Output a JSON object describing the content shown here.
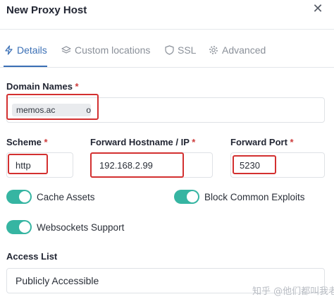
{
  "modal": {
    "title": "New Proxy Host",
    "close_icon": "close-icon"
  },
  "tabs": [
    {
      "label": "Details",
      "icon": "bolt-icon",
      "active": true
    },
    {
      "label": "Custom locations",
      "icon": "layers-icon",
      "active": false
    },
    {
      "label": "SSL",
      "icon": "shield-icon",
      "active": false
    },
    {
      "label": "Advanced",
      "icon": "gear-icon",
      "active": false
    }
  ],
  "form": {
    "domain_names": {
      "label": "Domain Names",
      "required_mark": "*",
      "chip_start": "memos.ac",
      "chip_end": "om"
    },
    "scheme": {
      "label": "Scheme",
      "required_mark": "*",
      "value": "http"
    },
    "forward_hostname": {
      "label": "Forward Hostname / IP",
      "required_mark": "*",
      "value": "192.168.2.99"
    },
    "forward_port": {
      "label": "Forward Port",
      "required_mark": "*",
      "value": "5230"
    },
    "toggles": {
      "cache_assets": {
        "label": "Cache Assets",
        "on": true
      },
      "block_exploits": {
        "label": "Block Common Exploits",
        "on": true
      },
      "websockets": {
        "label": "Websockets Support",
        "on": true
      }
    },
    "access_list": {
      "label": "Access List",
      "value": "Publicly Accessible"
    }
  },
  "watermark": "知乎 @他们都叫我老宇",
  "colors": {
    "accent": "#3a6fb5",
    "toggle_on": "#36b5a2",
    "highlight": "#d33030"
  }
}
